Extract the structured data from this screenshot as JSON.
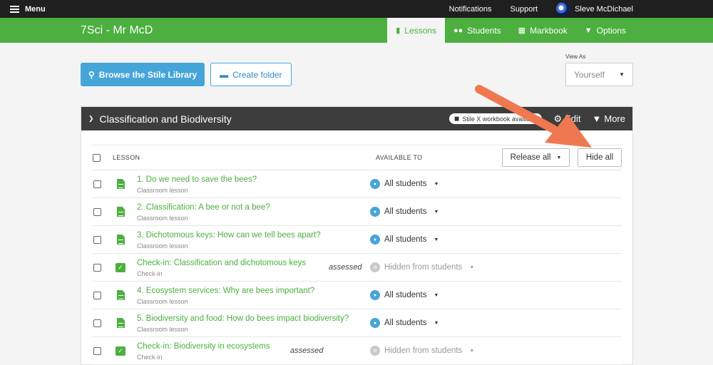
{
  "topbar": {
    "menu_label": "Menu",
    "notifications_label": "Notifications",
    "support_label": "Support",
    "user_name": "Sleve McDichael"
  },
  "class_title": "7Sci - Mr McD",
  "nav": {
    "lessons": "Lessons",
    "students": "Students",
    "markbook": "Markbook",
    "options": "Options"
  },
  "actions": {
    "browse_label": "Browse the Stile Library",
    "create_folder_label": "Create folder"
  },
  "view_as": {
    "label": "View As",
    "value": "Yourself"
  },
  "folder": {
    "title": "Classification and Biodiversity",
    "badge": "Stile X workbook available",
    "edit_label": "Edit",
    "more_label": "More",
    "col_lesson": "LESSON",
    "col_available": "AVAILABLE TO",
    "release_all_label": "Release all",
    "hide_all_label": "Hide all",
    "lessons": [
      {
        "title": "1. Do we need to save the bees?",
        "type": "Classroom lesson",
        "availability": "All students",
        "assessed": ""
      },
      {
        "title": "2. Classification: A bee or not a bee?",
        "type": "Classroom lesson",
        "availability": "All students",
        "assessed": ""
      },
      {
        "title": "3. Dichotomous keys: How can we tell bees apart?",
        "type": "Classroom lesson",
        "availability": "All students",
        "assessed": ""
      },
      {
        "title": "Check-in: Classification and dichotomous keys",
        "type": "Check-in",
        "availability": "Hidden from students",
        "assessed": "assessed"
      },
      {
        "title": "4. Ecosystem services: Why are bees important?",
        "type": "Classroom lesson",
        "availability": "All students",
        "assessed": ""
      },
      {
        "title": "5. Biodiversity and food: How do bees impact biodiversity?",
        "type": "Classroom lesson",
        "availability": "All students",
        "assessed": ""
      },
      {
        "title": "Check-in: Biodiversity in ecosystems",
        "type": "Check-in",
        "availability": "Hidden from students",
        "assessed": "assessed"
      }
    ]
  },
  "colors": {
    "green": "#4caf3f",
    "blue": "#45a5d9",
    "arrow": "#f07850",
    "dark": "#1f1f1f"
  }
}
